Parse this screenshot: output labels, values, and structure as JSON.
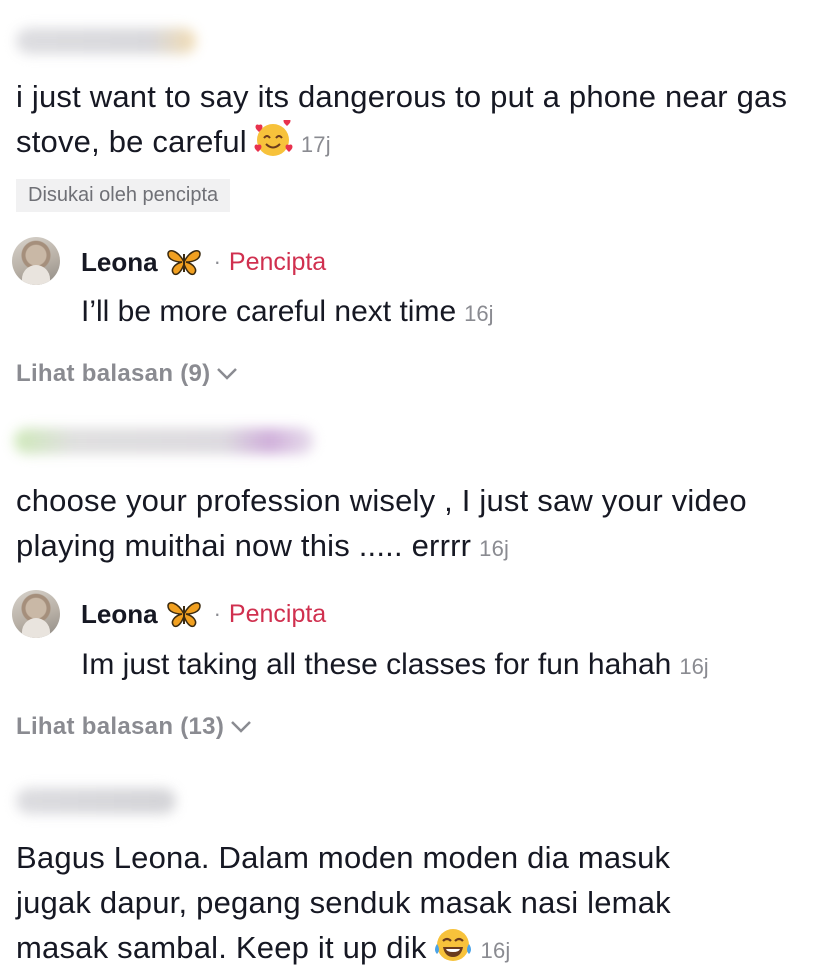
{
  "comments": [
    {
      "text": "i just want to say its dangerous to put a phone near gas stove, be careful",
      "emoji": "smiling-face-with-hearts",
      "time": "17j",
      "liked_badge": "Disukai oleh pencipta",
      "reply": {
        "name": "Leona",
        "creator_label": "Pencipta",
        "separator": "·",
        "text": "I’ll be more careful next time",
        "time": "16j"
      },
      "view_replies": "Lihat balasan (9)"
    },
    {
      "text": "choose your profession wisely , I just saw your video playing muithai now this ..... errrr",
      "time": "16j",
      "reply": {
        "name": "Leona",
        "creator_label": "Pencipta",
        "separator": "·",
        "text": "Im just taking all these classes for fun hahah",
        "time": "16j"
      },
      "view_replies": "Lihat balasan (13)"
    },
    {
      "text_line1": "Bagus Leona. Dalam moden moden dia masuk",
      "text_line2": "jugak dapur, pegang senduk masak nasi lemak",
      "text_line3": "masak sambal. Keep it up dik",
      "emoji": "tears-of-joy",
      "time": "16j"
    }
  ],
  "colors": {
    "text": "#161823",
    "muted": "#8a8b91",
    "creator": "#d0304f",
    "badge_bg": "#f1f1f2"
  }
}
